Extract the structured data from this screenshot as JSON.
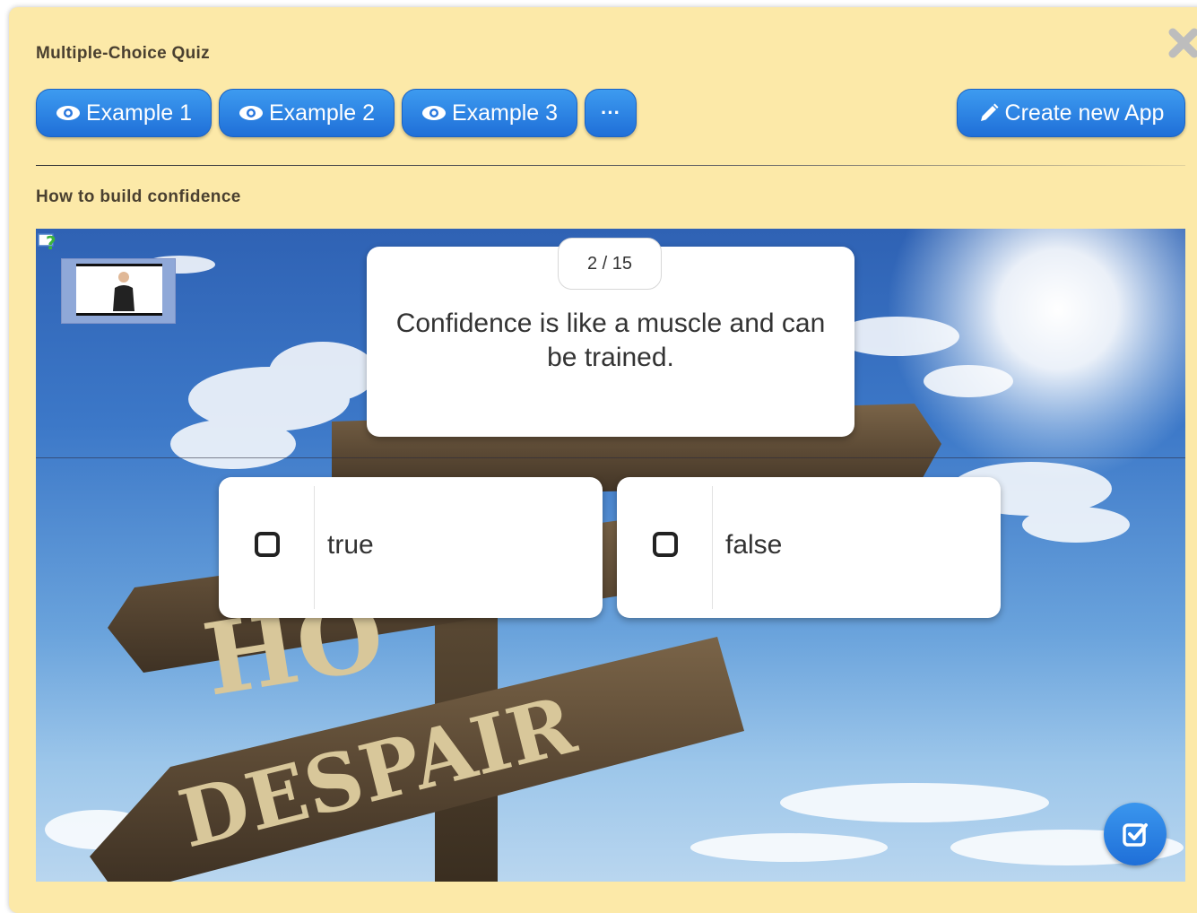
{
  "app": {
    "title": "Multiple-Choice Quiz"
  },
  "toolbar": {
    "buttons": [
      {
        "label": "Example 1",
        "icon": "eye-icon"
      },
      {
        "label": "Example 2",
        "icon": "eye-icon"
      },
      {
        "label": "Example 3",
        "icon": "eye-icon"
      },
      {
        "label": "···",
        "icon": "more-icon"
      }
    ],
    "create": {
      "label": "Create new App",
      "icon": "pencil-icon"
    }
  },
  "quiz": {
    "title": "How to build confidence",
    "counter": "2 / 15",
    "question": "Confidence is like a muscle and can be trained.",
    "answers": [
      {
        "label": "true",
        "checked": false
      },
      {
        "label": "false",
        "checked": false
      }
    ]
  },
  "background": {
    "sign_word": "DESPAIR",
    "sign_word_partial": "HO"
  },
  "colors": {
    "panel": "#fce9a8",
    "button": "#2b80e3",
    "text": "#4a4030"
  }
}
